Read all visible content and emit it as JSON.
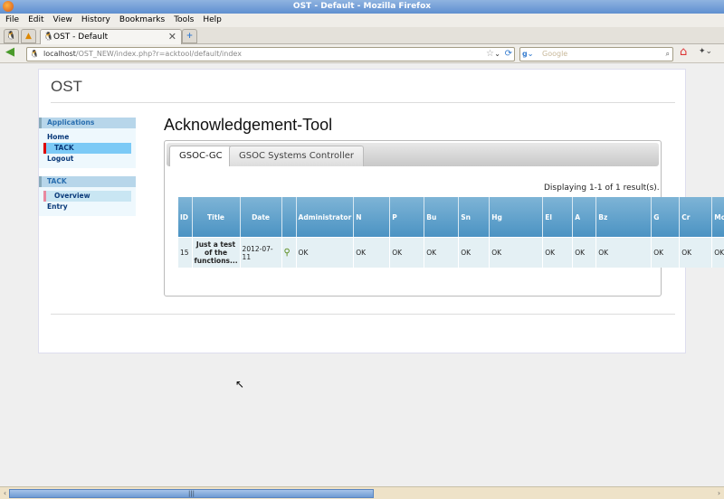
{
  "window": {
    "title": "OST - Default - Mozilla Firefox"
  },
  "menu": [
    "File",
    "Edit",
    "View",
    "History",
    "Bookmarks",
    "Tools",
    "Help"
  ],
  "tabs": {
    "active": "OST - Default"
  },
  "nav": {
    "url_host": "localhost",
    "url_path": "/OST_NEW/index.php?r=acktool/default/index",
    "search_placeholder": "Google"
  },
  "page": {
    "brand": "OST",
    "heading": "Acknowledgement-Tool",
    "sidebar": {
      "applications_header": "Applications",
      "applications": [
        "Home",
        "TACK",
        "Logout"
      ],
      "tack_header": "TACK",
      "tack": [
        "Overview",
        "Entry"
      ]
    },
    "panel_tabs": [
      "GSOC-GC",
      "GSOC Systems Controller"
    ],
    "summary": "Displaying 1-1 of 1 result(s).",
    "columns": [
      "ID",
      "Title",
      "Date",
      "",
      "Administrator",
      "N",
      "P",
      "Bu",
      "Sn",
      "Hg",
      "El",
      "A",
      "Bz",
      "G",
      "Cr",
      "Mc"
    ],
    "rows": [
      [
        "15",
        "Just a test of the functions...",
        "2012-07-11",
        "",
        "OK",
        "OK",
        "OK",
        "OK",
        "OK",
        "OK",
        "OK",
        "OK",
        "OK",
        "OK",
        "OK",
        "OK"
      ]
    ]
  },
  "scrollbar": {
    "horizontal_position": 0.0,
    "visible_fraction": 0.51
  }
}
